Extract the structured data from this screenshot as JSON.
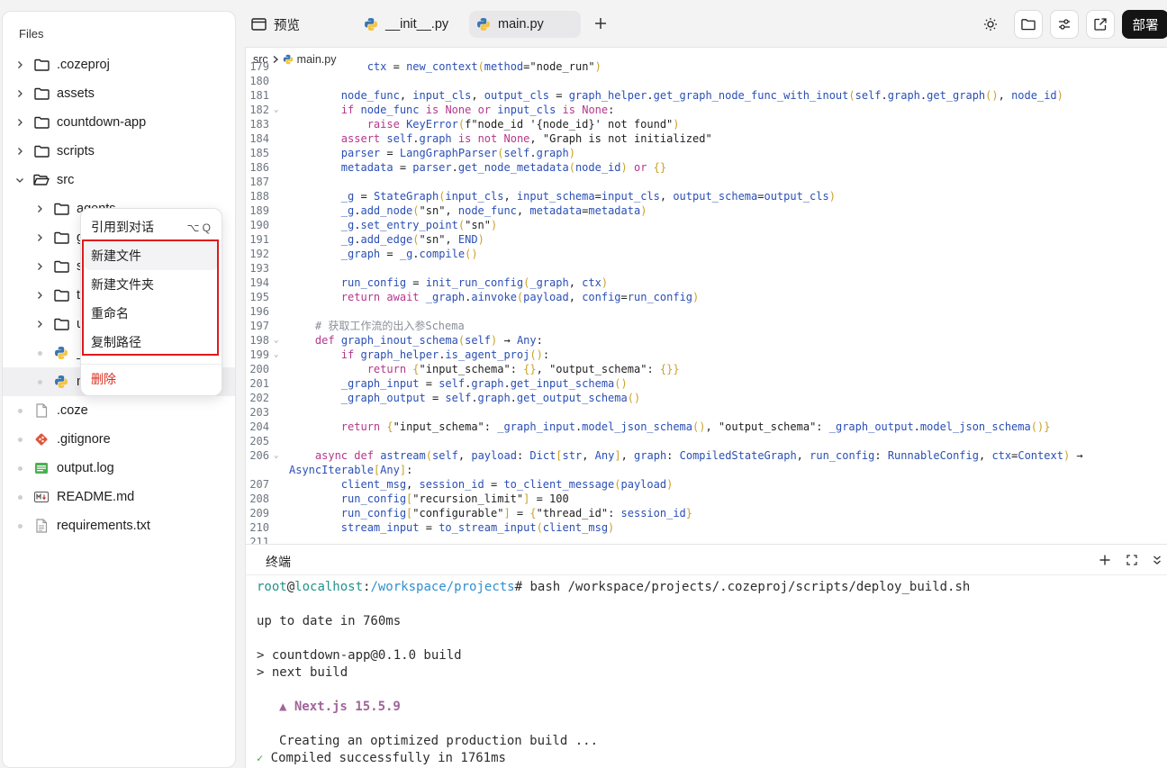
{
  "sidebar": {
    "title": "Files",
    "items": [
      {
        "label": ".cozeproj",
        "kind": "folder"
      },
      {
        "label": "assets",
        "kind": "folder"
      },
      {
        "label": "countdown-app",
        "kind": "folder"
      },
      {
        "label": "scripts",
        "kind": "folder"
      },
      {
        "label": "src",
        "kind": "folder-open"
      },
      {
        "label": "agents",
        "kind": "folder"
      },
      {
        "label": "gr",
        "kind": "folder"
      },
      {
        "label": "st",
        "kind": "folder"
      },
      {
        "label": "to",
        "kind": "folder"
      },
      {
        "label": "ut",
        "kind": "folder"
      },
      {
        "label": "_",
        "kind": "python"
      },
      {
        "label": "m",
        "kind": "python"
      },
      {
        "label": ".coze",
        "kind": "file"
      },
      {
        "label": ".gitignore",
        "kind": "git"
      },
      {
        "label": "output.log",
        "kind": "log"
      },
      {
        "label": "README.md",
        "kind": "markdown"
      },
      {
        "label": "requirements.txt",
        "kind": "file"
      }
    ]
  },
  "tabs": [
    {
      "label": "预览",
      "icon": "preview-icon"
    },
    {
      "label": "__init__.py",
      "icon": "python-icon"
    },
    {
      "label": "main.py",
      "icon": "python-icon",
      "active": true
    }
  ],
  "toolbar": {
    "deploy_label": "部署"
  },
  "editor": {
    "breadcrumb": {
      "folder": "src",
      "file": "main.py"
    },
    "lines": [
      {
        "n": "179",
        "t": "            ctx = new_context(method=\"node_run\")"
      },
      {
        "n": "180",
        "t": ""
      },
      {
        "n": "181",
        "t": "        node_func, input_cls, output_cls = graph_helper.get_graph_node_func_with_inout(self.graph.get_graph(), node_id)"
      },
      {
        "n": "182",
        "t": "        if node_func is None or input_cls is None:",
        "fold": true
      },
      {
        "n": "183",
        "t": "            raise KeyError(f\"node_id '{node_id}' not found\")"
      },
      {
        "n": "184",
        "t": "        assert self.graph is not None, \"Graph is not initialized\""
      },
      {
        "n": "185",
        "t": "        parser = LangGraphParser(self.graph)"
      },
      {
        "n": "186",
        "t": "        metadata = parser.get_node_metadata(node_id) or {}"
      },
      {
        "n": "187",
        "t": ""
      },
      {
        "n": "188",
        "t": "        _g = StateGraph(input_cls, input_schema=input_cls, output_schema=output_cls)"
      },
      {
        "n": "189",
        "t": "        _g.add_node(\"sn\", node_func, metadata=metadata)"
      },
      {
        "n": "190",
        "t": "        _g.set_entry_point(\"sn\")"
      },
      {
        "n": "191",
        "t": "        _g.add_edge(\"sn\", END)"
      },
      {
        "n": "192",
        "t": "        _graph = _g.compile()"
      },
      {
        "n": "193",
        "t": ""
      },
      {
        "n": "194",
        "t": "        run_config = init_run_config(_graph, ctx)"
      },
      {
        "n": "195",
        "t": "        return await _graph.ainvoke(payload, config=run_config)"
      },
      {
        "n": "196",
        "t": ""
      },
      {
        "n": "197",
        "t": "    # 获取工作流的出入参Schema"
      },
      {
        "n": "198",
        "t": "    def graph_inout_schema(self) → Any:",
        "fold": true
      },
      {
        "n": "199",
        "t": "        if graph_helper.is_agent_proj():",
        "fold": true
      },
      {
        "n": "200",
        "t": "            return {\"input_schema\": {}, \"output_schema\": {}}"
      },
      {
        "n": "201",
        "t": "        _graph_input = self.graph.get_input_schema()"
      },
      {
        "n": "202",
        "t": "        _graph_output = self.graph.get_output_schema()"
      },
      {
        "n": "203",
        "t": ""
      },
      {
        "n": "204",
        "t": "        return {\"input_schema\": _graph_input.model_json_schema(), \"output_schema\": _graph_output.model_json_schema()}"
      },
      {
        "n": "205",
        "t": ""
      },
      {
        "n": "206",
        "t": "    async def astream(self, payload: Dict[str, Any], graph: CompiledStateGraph, run_config: RunnableConfig, ctx=Context) →",
        "fold": true
      },
      {
        "n": "",
        "t": "AsyncIterable[Any]:",
        "wrap": true
      },
      {
        "n": "207",
        "t": "        client_msg, session_id = to_client_message(payload)"
      },
      {
        "n": "208",
        "t": "        run_config[\"recursion_limit\"] = 100"
      },
      {
        "n": "209",
        "t": "        run_config[\"configurable\"] = {\"thread_id\": session_id}"
      },
      {
        "n": "210",
        "t": "        stream_input = to_stream_input(client_msg)"
      },
      {
        "n": "211",
        "t": ""
      }
    ]
  },
  "terminal": {
    "title": "终端",
    "prompt_user": "root",
    "prompt_host": "localhost",
    "prompt_path": "/workspace/projects",
    "prompt_cmd": "# bash /workspace/projects/.cozeproj/scripts/deploy_build.sh",
    "lines": [
      "up to date in 760ms",
      "> countdown-app@0.1.0 build",
      "> next build",
      "▲ Next.js 15.5.9",
      "Creating an optimized production build ...",
      "Compiled successfully in 1761ms"
    ],
    "check_mark": "✓"
  },
  "context_menu": {
    "items": [
      {
        "label": "引用到对话",
        "shortcut": "⌥ Q"
      },
      {
        "label": "新建文件"
      },
      {
        "label": "新建文件夹"
      },
      {
        "label": "重命名"
      },
      {
        "label": "复制路径"
      },
      {
        "label": "删除",
        "danger": true
      }
    ],
    "danger_color": "#d92d20",
    "highlight_color": "#e0191c"
  }
}
